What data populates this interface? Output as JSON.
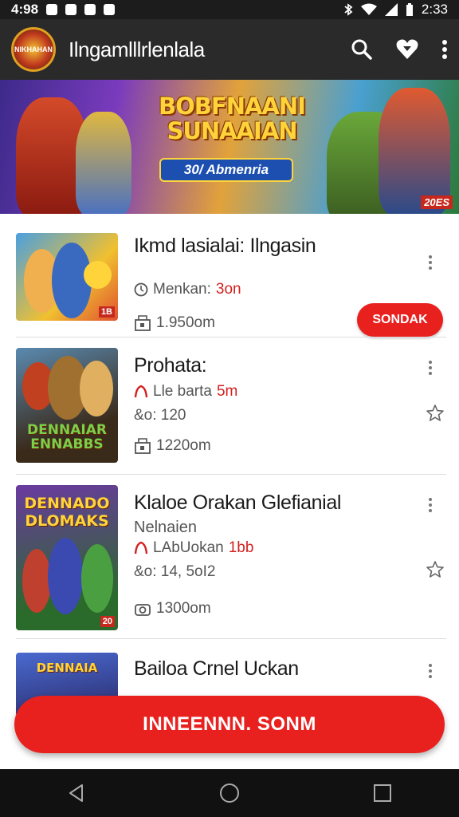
{
  "status_bar": {
    "time_left": "4:98",
    "time_right": "2:33"
  },
  "app_bar": {
    "logo_text": "NIKHAHAN",
    "title": "Ilngamlllrlenlala",
    "icons": [
      "search-icon",
      "heart-icon",
      "more-vert-icon"
    ]
  },
  "banner": {
    "title_line1": "BOBFNAANI",
    "title_line2": "SUNAAIAN",
    "pill": "30/ Abmenria",
    "year": "20ES"
  },
  "items": [
    {
      "title": "Ikmd lasialai: Ilngasin",
      "line1_prefix": "Menkan:",
      "line1_red": "3on",
      "size": "1.950om",
      "action": "SONDAK",
      "thumb_label": "",
      "thumb_badge": "1B"
    },
    {
      "title": "Prohata:",
      "line1_prefix": "Lle barta",
      "line1_red": "5m",
      "line2": "&o: 120",
      "size": "1220om",
      "thumb_label": "DENNAIAR ENNABBS",
      "thumb_badge": ""
    },
    {
      "title": "Klaloe Orakan Glefianial",
      "subtitle": "Nelnaien",
      "line1_prefix": "LAbUokan",
      "line1_red": "1bb",
      "line2": "&o: 14, 5oI2",
      "size": "1300om",
      "thumb_label": "DENNADO DLOMAKS",
      "thumb_badge": "20"
    },
    {
      "title": "Bailoa Crnel Uckan",
      "thumb_label": "DENNAIA"
    }
  ],
  "fab": {
    "label": "INNEENNN. SONM"
  },
  "colors": {
    "accent": "#e8211f",
    "app_bar": "#2a2a2a",
    "status_bar": "#1c1c1c"
  }
}
